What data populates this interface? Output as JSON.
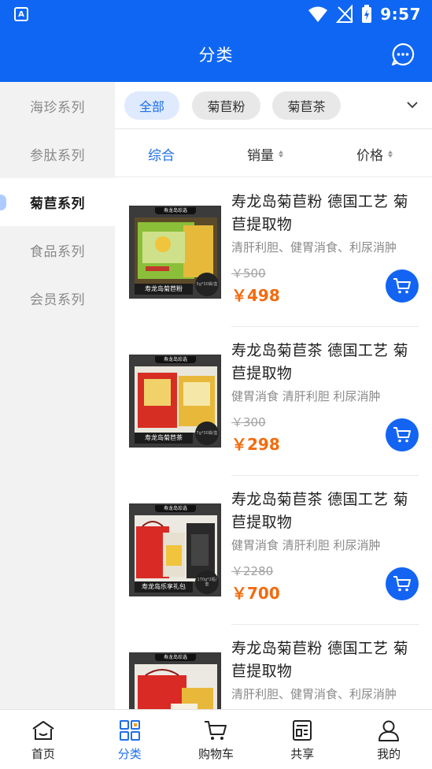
{
  "status_bar": {
    "app_badge": "A",
    "time": "9:57"
  },
  "header": {
    "title": "分类"
  },
  "sidebar": {
    "items": [
      {
        "label": "海珍系列",
        "active": false
      },
      {
        "label": "参肽系列",
        "active": false
      },
      {
        "label": "菊苣系列",
        "active": true
      },
      {
        "label": "食品系列",
        "active": false
      },
      {
        "label": "会员系列",
        "active": false
      }
    ]
  },
  "filter_tags": [
    {
      "label": "全部",
      "active": true
    },
    {
      "label": "菊苣粉",
      "active": false
    },
    {
      "label": "菊苣茶",
      "active": false
    }
  ],
  "sort_bar": {
    "comprehensive": "综合",
    "sales": "销量",
    "price": "价格"
  },
  "products": [
    {
      "title": "寿龙岛菊苣粉 德国工艺 菊苣提取物",
      "desc": "清肝利胆、健胃消食、利尿消肿",
      "old_price": "￥500",
      "price": "￥498",
      "image": {
        "brand": "寿龙岛珍选",
        "label": "寿龙岛菊苣粉",
        "circle": "5g*30袋/盒"
      }
    },
    {
      "title": "寿龙岛菊苣茶 德国工艺 菊苣提取物",
      "desc": "健胃消食 清肝利胆 利尿消肿",
      "old_price": "￥300",
      "price": "￥298",
      "image": {
        "brand": "寿龙岛珍选",
        "label": "寿龙岛菊苣茶",
        "circle": "7g*30袋/盒"
      }
    },
    {
      "title": "寿龙岛菊苣茶 德国工艺 菊苣提取物",
      "desc": "健胃消食 清肝利胆 利尿消肿",
      "old_price": "￥2280",
      "price": "￥700",
      "image": {
        "brand": "寿龙岛珍选",
        "label": "寿龙岛乐享礼包",
        "circle": "170g*2瓶/套"
      }
    },
    {
      "title": "寿龙岛菊苣粉 德国工艺 菊苣提取物",
      "desc": "清肝利胆、健胃消食、利尿消肿",
      "old_price": "",
      "price": "",
      "image": {
        "brand": "寿龙岛珍选",
        "label": "",
        "circle": ""
      }
    }
  ],
  "tabbar": {
    "items": [
      {
        "label": "首页",
        "icon": "home-icon",
        "active": false
      },
      {
        "label": "分类",
        "icon": "category-icon",
        "active": true
      },
      {
        "label": "购物车",
        "icon": "cart-icon",
        "active": false
      },
      {
        "label": "共享",
        "icon": "share-icon",
        "active": false
      },
      {
        "label": "我的",
        "icon": "user-icon",
        "active": false
      }
    ]
  },
  "colors": {
    "primary": "#0f66f2",
    "price": "#f36b0f",
    "sidebar_bg": "#f2f2f2"
  }
}
